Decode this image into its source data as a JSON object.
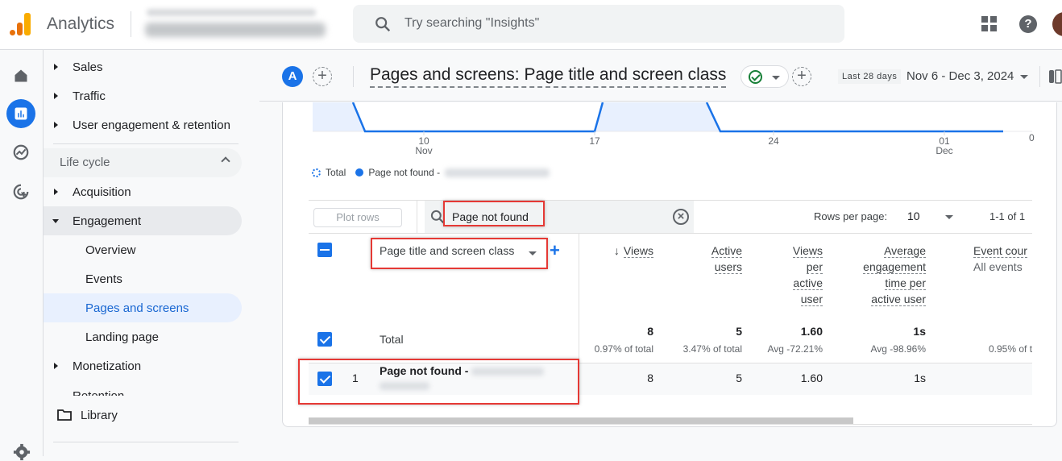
{
  "app": {
    "name": "Analytics",
    "search_placeholder": "Try searching \"Insights\"",
    "help_label": "?"
  },
  "rail": {
    "items": [
      {
        "icon": "home-icon",
        "label": "Home"
      },
      {
        "icon": "reports-icon",
        "label": "Reports",
        "active": true
      },
      {
        "icon": "explore-icon",
        "label": "Explore"
      },
      {
        "icon": "advertising-icon",
        "label": "Advertising"
      }
    ]
  },
  "nav": {
    "items": [
      {
        "label": "Sales"
      },
      {
        "label": "Traffic"
      },
      {
        "label": "User engagement & retention"
      }
    ],
    "section": "Life cycle",
    "lifecycle": [
      {
        "label": "Acquisition"
      },
      {
        "label": "Engagement"
      },
      {
        "label": "Overview"
      },
      {
        "label": "Events"
      },
      {
        "label": "Pages and screens"
      },
      {
        "label": "Landing page"
      },
      {
        "label": "Monetization"
      },
      {
        "label": "Retention"
      }
    ],
    "library": "Library"
  },
  "header": {
    "comparison_badge": "A",
    "title": "Pages and screens: Page title and screen class",
    "date_chip": "Last 28 days",
    "date_range": "Nov 6 - Dec 3, 2024"
  },
  "chart_data": {
    "type": "area",
    "x_ticks": [
      {
        "day": "10",
        "month": "Nov"
      },
      {
        "day": "17",
        "month": ""
      },
      {
        "day": "24",
        "month": ""
      },
      {
        "day": "01",
        "month": "Dec"
      }
    ],
    "y_ticks": [
      "0"
    ],
    "legend": [
      {
        "label": "Total",
        "style": "dotted"
      },
      {
        "label": "Page not found -",
        "style": "solid"
      }
    ],
    "series_color": "#1a73e8"
  },
  "table": {
    "plot_rows_label": "Plot rows",
    "search_value": "Page not found",
    "rows_per_page_label": "Rows per page:",
    "rows_per_page_value": "10",
    "pager": "1-1 of 1",
    "dimension": "Page title and screen class",
    "columns": [
      {
        "lines": [
          "Views"
        ],
        "sorted": true
      },
      {
        "lines": [
          "Active",
          "users"
        ]
      },
      {
        "lines": [
          "Views",
          "per",
          "active",
          "user"
        ]
      },
      {
        "lines": [
          "Average",
          "engagement",
          "time per",
          "active user"
        ]
      },
      {
        "lines": [
          "Event cour"
        ],
        "sub": "All events"
      }
    ],
    "total": {
      "label": "Total",
      "values": [
        "8",
        "5",
        "1.60",
        "1s",
        ""
      ],
      "subs": [
        "0.97% of total",
        "3.47% of total",
        "Avg -72.21%",
        "Avg -98.96%",
        "0.95% of t"
      ]
    },
    "rows": [
      {
        "index": "1",
        "name": "Page not found -",
        "values": [
          "8",
          "5",
          "1.60",
          "1s",
          ""
        ]
      }
    ]
  }
}
